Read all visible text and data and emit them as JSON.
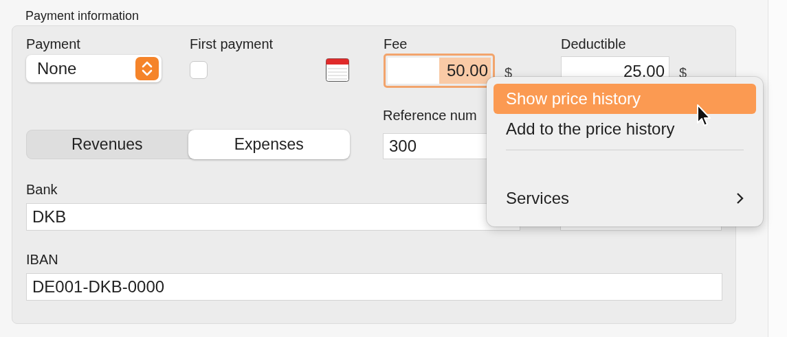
{
  "section_title": "Payment information",
  "payment": {
    "label": "Payment",
    "value": "None"
  },
  "first_payment": {
    "label": "First payment",
    "checked": false
  },
  "fee": {
    "label": "Fee",
    "value": "50.00",
    "currency": "$",
    "focused": true
  },
  "deductible": {
    "label": "Deductible",
    "value": "25.00",
    "currency": "$"
  },
  "segments": [
    {
      "label": "Revenues",
      "selected": false
    },
    {
      "label": "Expenses",
      "selected": true
    }
  ],
  "reference": {
    "label": "Reference num",
    "value": "300"
  },
  "bank": {
    "label": "Bank",
    "value": "DKB"
  },
  "iban": {
    "label": "IBAN",
    "value": "DE001-DKB-0000"
  },
  "context_menu": {
    "items": [
      {
        "kind": "item",
        "label": "Show price history",
        "selected": true
      },
      {
        "kind": "item",
        "label": "Add to the price history",
        "selected": false
      },
      {
        "kind": "separator"
      },
      {
        "kind": "blank"
      },
      {
        "kind": "submenu",
        "label": "Services",
        "selected": false
      }
    ]
  }
}
